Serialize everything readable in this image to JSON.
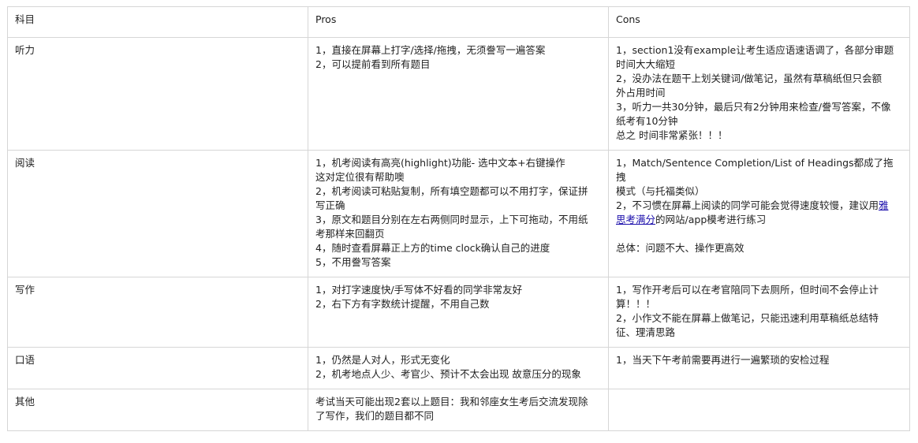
{
  "columns": {
    "subject": "科目",
    "pros": "Pros",
    "cons": "Cons"
  },
  "rows": [
    {
      "subject": "听力",
      "pros": [
        "1，直接在屏幕上打字/选择/拖拽，无须誊写一遍答案",
        "2，可以提前看到所有题目"
      ],
      "cons": [
        "1，section1没有example让考生适应语速语调了，各部分审题",
        "时间大大缩短",
        "2，没办法在题干上划关键词/做笔记，虽然有草稿纸但只会额",
        "外占用时间",
        "3，听力一共30分钟，最后只有2分钟用来检查/誊写答案，不像",
        "纸考有10分钟",
        "总之 时间非常紧张！！！"
      ]
    },
    {
      "subject": "阅读",
      "pros": [
        "1，机考阅读有高亮(highlight)功能- 选中文本+右键操作",
        "这对定位很有帮助噢",
        "2，机考阅读可粘贴复制，所有填空题都可以不用打字，保证拼",
        "写正确",
        "3，原文和题目分别在左右两侧同时显示，上下可拖动，不用纸",
        "考那样来回翻页",
        "4，随时查看屏幕正上方的time clock确认自己的进度",
        "5，不用誊写答案"
      ],
      "cons": {
        "line1": "1，Match/Sentence Completion/List of Headings都成了拖拽",
        "line2": "模式（与托福类似）",
        "line3_prefix": "2，不习惯在屏幕上阅读的同学可能会觉得速度较慢，建议用",
        "link_part1": "雅",
        "link_part2": "思考满分",
        "line4_suffix": "的网站/app模考进行练习",
        "summary": "总体：问题不大、操作更高效"
      }
    },
    {
      "subject": "写作",
      "pros": [
        "1，对打字速度快/手写体不好看的同学非常友好",
        "2，右下方有字数统计提醒，不用自己数"
      ],
      "cons": [
        "1，写作开考后可以在考官陪同下去厕所，但时间不会停止计",
        "算！！！",
        "2，小作文不能在屏幕上做笔记，只能迅速利用草稿纸总结特",
        "征、理清思路"
      ]
    },
    {
      "subject": "口语",
      "pros": [
        "1，仍然是人对人，形式无变化",
        "2，机考地点人少、考官少、预计不太会出现 故意压分的现象"
      ],
      "cons": [
        "1，当天下午考前需要再进行一遍繁琐的安检过程"
      ]
    },
    {
      "subject": "其他",
      "pros": [
        "考试当天可能出现2套以上题目：我和邻座女生考后交流发现除",
        "了写作，我们的题目都不同"
      ],
      "cons": []
    }
  ],
  "colors": {
    "border": "#d6d6d6",
    "text": "#1f1f1f",
    "link": "#1a0dab"
  }
}
